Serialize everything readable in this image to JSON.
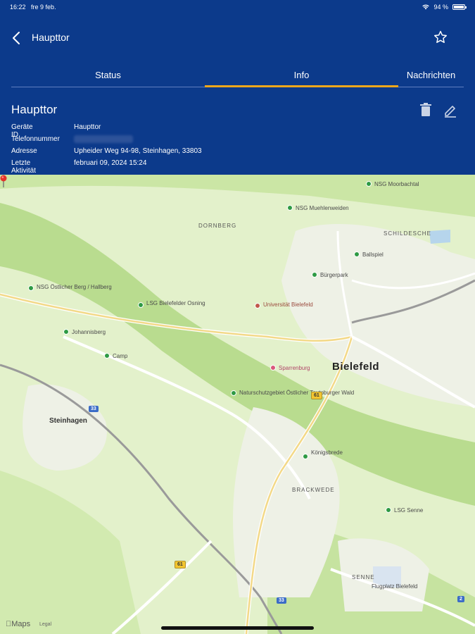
{
  "status_bar": {
    "time": "16:22",
    "date": "fre 9 feb.",
    "battery": "94 %"
  },
  "nav": {
    "title": "Haupttor"
  },
  "tabs": [
    {
      "label": "Status",
      "active": false
    },
    {
      "label": "Info",
      "active": true
    },
    {
      "label": "Nachrichten",
      "active": false
    }
  ],
  "device": {
    "title": "Haupttor",
    "fields": [
      {
        "label": "Geräte ID",
        "value": "Haupttor"
      },
      {
        "label": "Telefonnummer",
        "value": ""
      },
      {
        "label": "Adresse",
        "value": "Upheider Weg 94-98, Steinhagen, 33803"
      },
      {
        "label": "Letzte Aktivität",
        "value": "februari 09, 2024 15:24"
      }
    ]
  },
  "map": {
    "labels": {
      "city": "Bielefeld",
      "town": "Steinhagen",
      "dornberg": "DORNBERG",
      "schildesche": "SCHILDESCHE",
      "brackwede": "BRACKWEDE",
      "senne": "SENNE",
      "poi_uni": "Universität Bielefeld",
      "poi_obersee": "NSG Moorbachtal",
      "poi_gruppenteich": "NSG Muehlenweiden",
      "poi_johannis": "Johannisberg",
      "poi_ballspiel": "Ballspiel",
      "poi_buergerpark": "Bürgerpark",
      "poi_sportplatz": "LSG Bielefelder Osning",
      "poi_koenigsbrede": "Königsbrede",
      "poi_natur": "Naturschutzgebiet Östlicher Teutoburger Wald",
      "poi_lsg": "LSG Senne",
      "poi_sparrenburg": "Sparrenburg",
      "poi_camp": "Camp",
      "poi_hallstein": "NSG Östlicher Berg / Hallberg",
      "poi_airport": "Flugplatz Bielefeld",
      "shield_33": "33",
      "shield_61a": "61",
      "shield_61b": "61",
      "shield_33b": "33",
      "shield_2": "2"
    },
    "attribution": "Maps",
    "legal": "Legal"
  },
  "colors": {
    "header_bg": "#0c3a8b",
    "tab_indicator": "#f0a71b",
    "map_land": "#dff0c4",
    "forest": "#b8dc8e"
  },
  "icons": {
    "back": "chevron-left-icon",
    "favorite": "star-icon",
    "delete": "trash-icon",
    "edit": "pencil-icon"
  }
}
